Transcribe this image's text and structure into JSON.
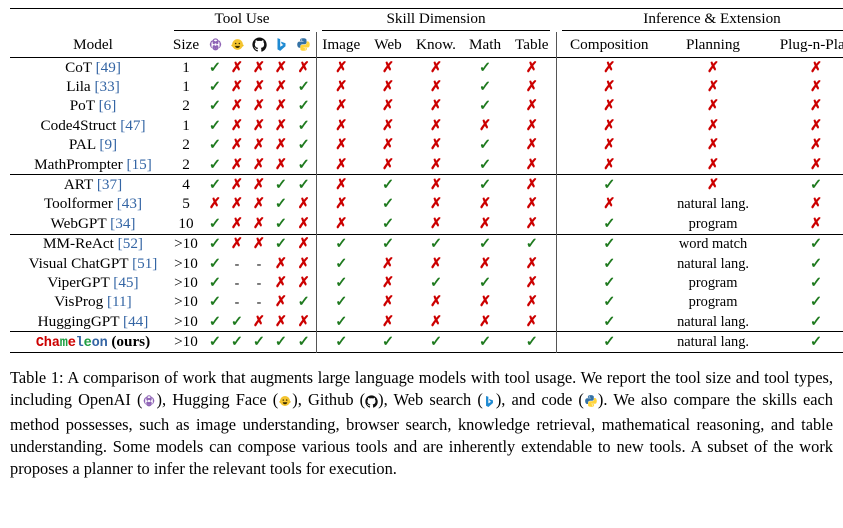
{
  "table": {
    "group_headers": [
      {
        "label": "Tool Use",
        "span": 6
      },
      {
        "label": "Skill Dimension",
        "span": 5
      },
      {
        "label": "Inference & Extension",
        "span": 3
      }
    ],
    "columns": [
      {
        "key": "model",
        "label": "Model"
      },
      {
        "key": "size",
        "label": "Size"
      },
      {
        "key": "openai",
        "label": "",
        "icon": "openai-icon"
      },
      {
        "key": "huggingface",
        "label": "",
        "icon": "huggingface-icon"
      },
      {
        "key": "github",
        "label": "",
        "icon": "github-icon"
      },
      {
        "key": "bing",
        "label": "",
        "icon": "bing-icon"
      },
      {
        "key": "python",
        "label": "",
        "icon": "python-icon"
      },
      {
        "key": "image",
        "label": "Image"
      },
      {
        "key": "web",
        "label": "Web"
      },
      {
        "key": "know",
        "label": "Know."
      },
      {
        "key": "math",
        "label": "Math"
      },
      {
        "key": "table",
        "label": "Table"
      },
      {
        "key": "composition",
        "label": "Composition"
      },
      {
        "key": "planning",
        "label": "Planning"
      },
      {
        "key": "plugnplay",
        "label": "Plug-n-Play"
      }
    ],
    "groups": [
      {
        "rows": [
          {
            "name": "CoT",
            "ref": "[49]",
            "size": "1",
            "tools": [
              "yes",
              "no",
              "no",
              "no",
              "no"
            ],
            "skills": [
              "no",
              "no",
              "no",
              "yes",
              "no"
            ],
            "composition": "no",
            "planning": "no",
            "plugnplay": "no"
          },
          {
            "name": "Lila",
            "ref": "[33]",
            "size": "1",
            "tools": [
              "yes",
              "no",
              "no",
              "no",
              "yes"
            ],
            "skills": [
              "no",
              "no",
              "no",
              "yes",
              "no"
            ],
            "composition": "no",
            "planning": "no",
            "plugnplay": "no"
          },
          {
            "name": "PoT",
            "ref": "[6]",
            "size": "2",
            "tools": [
              "yes",
              "no",
              "no",
              "no",
              "yes"
            ],
            "skills": [
              "no",
              "no",
              "no",
              "yes",
              "no"
            ],
            "composition": "no",
            "planning": "no",
            "plugnplay": "no"
          },
          {
            "name": "Code4Struct",
            "ref": "[47]",
            "size": "1",
            "tools": [
              "yes",
              "no",
              "no",
              "no",
              "yes"
            ],
            "skills": [
              "no",
              "no",
              "no",
              "no",
              "no"
            ],
            "composition": "no",
            "planning": "no",
            "plugnplay": "no"
          },
          {
            "name": "PAL",
            "ref": "[9]",
            "size": "2",
            "tools": [
              "yes",
              "no",
              "no",
              "no",
              "yes"
            ],
            "skills": [
              "no",
              "no",
              "no",
              "yes",
              "no"
            ],
            "composition": "no",
            "planning": "no",
            "plugnplay": "no"
          },
          {
            "name": "MathPrompter",
            "ref": "[15]",
            "size": "2",
            "tools": [
              "yes",
              "no",
              "no",
              "no",
              "yes"
            ],
            "skills": [
              "no",
              "no",
              "no",
              "yes",
              "no"
            ],
            "composition": "no",
            "planning": "no",
            "plugnplay": "no"
          }
        ]
      },
      {
        "rows": [
          {
            "name": "ART",
            "ref": "[37]",
            "size": "4",
            "tools": [
              "yes",
              "no",
              "no",
              "yes",
              "yes"
            ],
            "skills": [
              "no",
              "yes",
              "no",
              "yes",
              "no"
            ],
            "composition": "yes",
            "planning": "no",
            "plugnplay": "yes"
          },
          {
            "name": "Toolformer",
            "ref": "[43]",
            "size": "5",
            "tools": [
              "no",
              "no",
              "no",
              "yes",
              "no"
            ],
            "skills": [
              "no",
              "yes",
              "no",
              "no",
              "no"
            ],
            "composition": "no",
            "planning": "natural lang.",
            "plugnplay": "no"
          },
          {
            "name": "WebGPT",
            "ref": "[34]",
            "size": "10",
            "tools": [
              "yes",
              "no",
              "no",
              "yes",
              "no"
            ],
            "skills": [
              "no",
              "yes",
              "no",
              "no",
              "no"
            ],
            "composition": "yes",
            "planning": "program",
            "plugnplay": "no"
          }
        ]
      },
      {
        "rows": [
          {
            "name": "MM-ReAct",
            "ref": "[52]",
            "size": ">10",
            "tools": [
              "yes",
              "no",
              "no",
              "yes",
              "no"
            ],
            "skills": [
              "yes",
              "yes",
              "yes",
              "yes",
              "yes"
            ],
            "composition": "yes",
            "planning": "word match",
            "plugnplay": "yes"
          },
          {
            "name": "Visual ChatGPT",
            "ref": "[51]",
            "size": ">10",
            "tools": [
              "yes",
              "dash",
              "dash",
              "no",
              "no"
            ],
            "skills": [
              "yes",
              "no",
              "no",
              "no",
              "no"
            ],
            "composition": "yes",
            "planning": "natural lang.",
            "plugnplay": "yes"
          },
          {
            "name": "ViperGPT",
            "ref": "[45]",
            "size": ">10",
            "tools": [
              "yes",
              "dash",
              "dash",
              "no",
              "no"
            ],
            "skills": [
              "yes",
              "no",
              "yes",
              "yes",
              "no"
            ],
            "composition": "yes",
            "planning": "program",
            "plugnplay": "yes"
          },
          {
            "name": "VisProg",
            "ref": "[11]",
            "size": ">10",
            "tools": [
              "yes",
              "dash",
              "dash",
              "no",
              "yes"
            ],
            "skills": [
              "yes",
              "no",
              "no",
              "no",
              "no"
            ],
            "composition": "yes",
            "planning": "program",
            "plugnplay": "yes"
          },
          {
            "name": "HuggingGPT",
            "ref": "[44]",
            "size": ">10",
            "tools": [
              "yes",
              "yes",
              "no",
              "no",
              "no"
            ],
            "skills": [
              "yes",
              "no",
              "no",
              "no",
              "no"
            ],
            "composition": "yes",
            "planning": "natural lang.",
            "plugnplay": "yes"
          }
        ]
      },
      {
        "rows": [
          {
            "name": "Chameleon",
            "ref": "(ours)",
            "ours": true,
            "size": ">10",
            "tools": [
              "yes",
              "yes",
              "yes",
              "yes",
              "yes"
            ],
            "skills": [
              "yes",
              "yes",
              "yes",
              "yes",
              "yes"
            ],
            "composition": "yes",
            "planning": "natural lang.",
            "plugnplay": "yes"
          }
        ]
      }
    ]
  },
  "marks": {
    "yes": "✓",
    "no": "✗",
    "dash": "-"
  },
  "chameleon_letters": [
    {
      "ch": "C",
      "color": "#cc0000"
    },
    {
      "ch": "h",
      "color": "#cc0000"
    },
    {
      "ch": "a",
      "color": "#cc0000"
    },
    {
      "ch": "m",
      "color": "#1f9e42"
    },
    {
      "ch": "e",
      "color": "#cc0000"
    },
    {
      "ch": "l",
      "color": "#3465a4"
    },
    {
      "ch": "e",
      "color": "#1f9e42"
    },
    {
      "ch": "o",
      "color": "#3465a4"
    },
    {
      "ch": "n",
      "color": "#3465a4"
    }
  ],
  "caption": {
    "label": "Table 1:",
    "part1": " A comparison of work that augments large language models with tool usage. We report the tool size and tool types, including OpenAI (",
    "part2": "), Hugging Face (",
    "part3": "), Github (",
    "part4": "), Web search (",
    "part5": "), and code (",
    "part6": "). We also compare the skills each method possesses, such as image understanding, browser search, knowledge retrieval, mathematical reasoning, and table understanding. Some models can compose various tools and are inherently extendable to new tools. A subset of the work proposes a planner to infer the relevant tools for execution."
  },
  "colors": {
    "yes": "#1f7a1f",
    "no": "#cc0000",
    "ref_link": "#3465a4",
    "rule": "#000000",
    "openai": "#8e63b5",
    "huggingface": "#f4c430",
    "github": "#111111",
    "bing": "#1f8ad2",
    "python_blue": "#3572a5",
    "python_yellow": "#ffd43b"
  }
}
